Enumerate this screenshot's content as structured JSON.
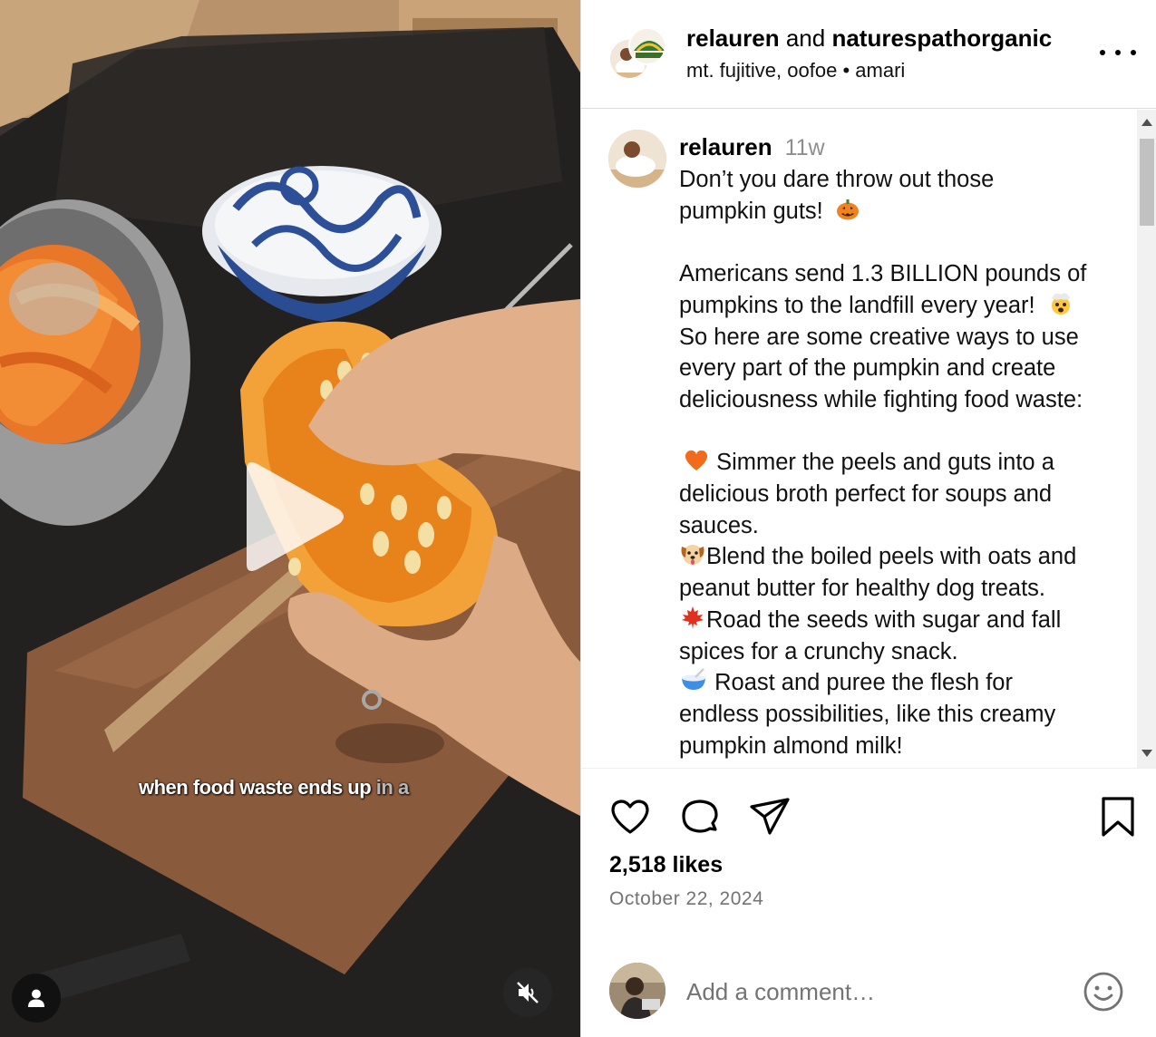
{
  "video": {
    "caption_main": "when food waste ends up",
    "caption_dim": " in a"
  },
  "header": {
    "user1": "relauren",
    "joiner": "and",
    "user2": "naturespathorganic",
    "subtitle_left": "mt. fujitive, oofoe",
    "subtitle_sep": "•",
    "subtitle_right": "amari"
  },
  "comment": {
    "username": "relauren",
    "time": "11w",
    "lines": [
      "Don’t you dare throw out those",
      "pumpkin guts!",
      "",
      "Americans send 1.3 BILLION pounds of",
      "pumpkins to the landfill every year!",
      "So here are some creative ways to use",
      "every part of the pumpkin and create",
      "deliciousness while fighting food waste:",
      "",
      "Simmer the peels and guts into a",
      "delicious broth perfect for soups and",
      "sauces.",
      "Blend the boiled peels with oats and",
      "peanut butter for healthy dog treats.",
      "Road the seeds with sugar and fall",
      "spices for a crunchy snack.",
      "Roast and puree the flesh for",
      "endless possibilities, like this creamy",
      "pumpkin almond milk!"
    ]
  },
  "emoji": {
    "line2": "jack-o-lantern-emoji",
    "line5": "exploding-head-emoji",
    "line10": "orange-heart-emoji",
    "line13": "dog-face-emoji",
    "line15": "maple-leaf-emoji",
    "line17": "bowl-with-spoon-emoji"
  },
  "stats": {
    "likes": "2,518 likes",
    "date": "October 22, 2024"
  },
  "add_comment": {
    "placeholder": "Add a comment…"
  },
  "colors": {
    "text": "#000000",
    "muted": "#737373",
    "divider": "#dbdbdb"
  }
}
